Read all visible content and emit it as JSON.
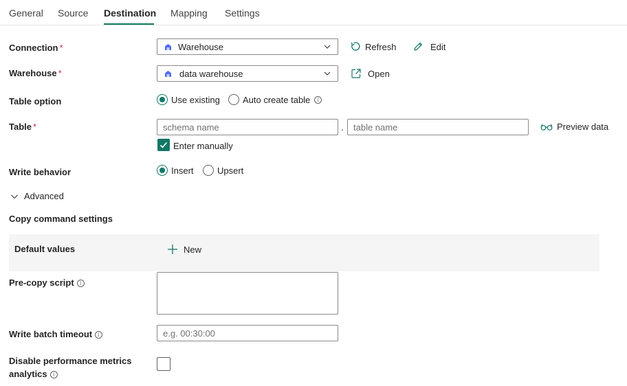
{
  "tabs": [
    {
      "label": "General",
      "active": false
    },
    {
      "label": "Source",
      "active": false
    },
    {
      "label": "Destination",
      "active": true
    },
    {
      "label": "Mapping",
      "active": false
    },
    {
      "label": "Settings",
      "active": false
    }
  ],
  "connection": {
    "label": "Connection",
    "required_mark": "*",
    "value": "Warehouse",
    "refresh_label": "Refresh",
    "edit_label": "Edit"
  },
  "warehouse": {
    "label": "Warehouse",
    "required_mark": "*",
    "value": "data warehouse",
    "open_label": "Open"
  },
  "table_option": {
    "label": "Table option",
    "options": [
      {
        "label": "Use existing",
        "selected": true
      },
      {
        "label": "Auto create table",
        "selected": false,
        "info": true
      }
    ]
  },
  "table": {
    "label": "Table",
    "required_mark": "*",
    "schema_placeholder": "schema name",
    "separator": ".",
    "table_placeholder": "table name",
    "preview_label": "Preview data",
    "enter_manually_label": "Enter manually",
    "enter_manually_checked": true
  },
  "write_behavior": {
    "label": "Write behavior",
    "options": [
      {
        "label": "Insert",
        "selected": true
      },
      {
        "label": "Upsert",
        "selected": false
      }
    ]
  },
  "advanced": {
    "label": "Advanced",
    "expanded": true
  },
  "copy_command": {
    "heading": "Copy command settings",
    "default_values_label": "Default values",
    "new_label": "New"
  },
  "pre_copy_script": {
    "label": "Pre-copy script",
    "value": ""
  },
  "write_batch_timeout": {
    "label": "Write batch timeout",
    "placeholder": "e.g. 00:30:00"
  },
  "disable_metrics": {
    "label_line1": "Disable performance metrics",
    "label_line2": "analytics",
    "checked": false
  },
  "colors": {
    "accent": "#117865",
    "required": "#c4314b",
    "warehouse_icon": "#4f6bed"
  },
  "info_glyph": "i"
}
